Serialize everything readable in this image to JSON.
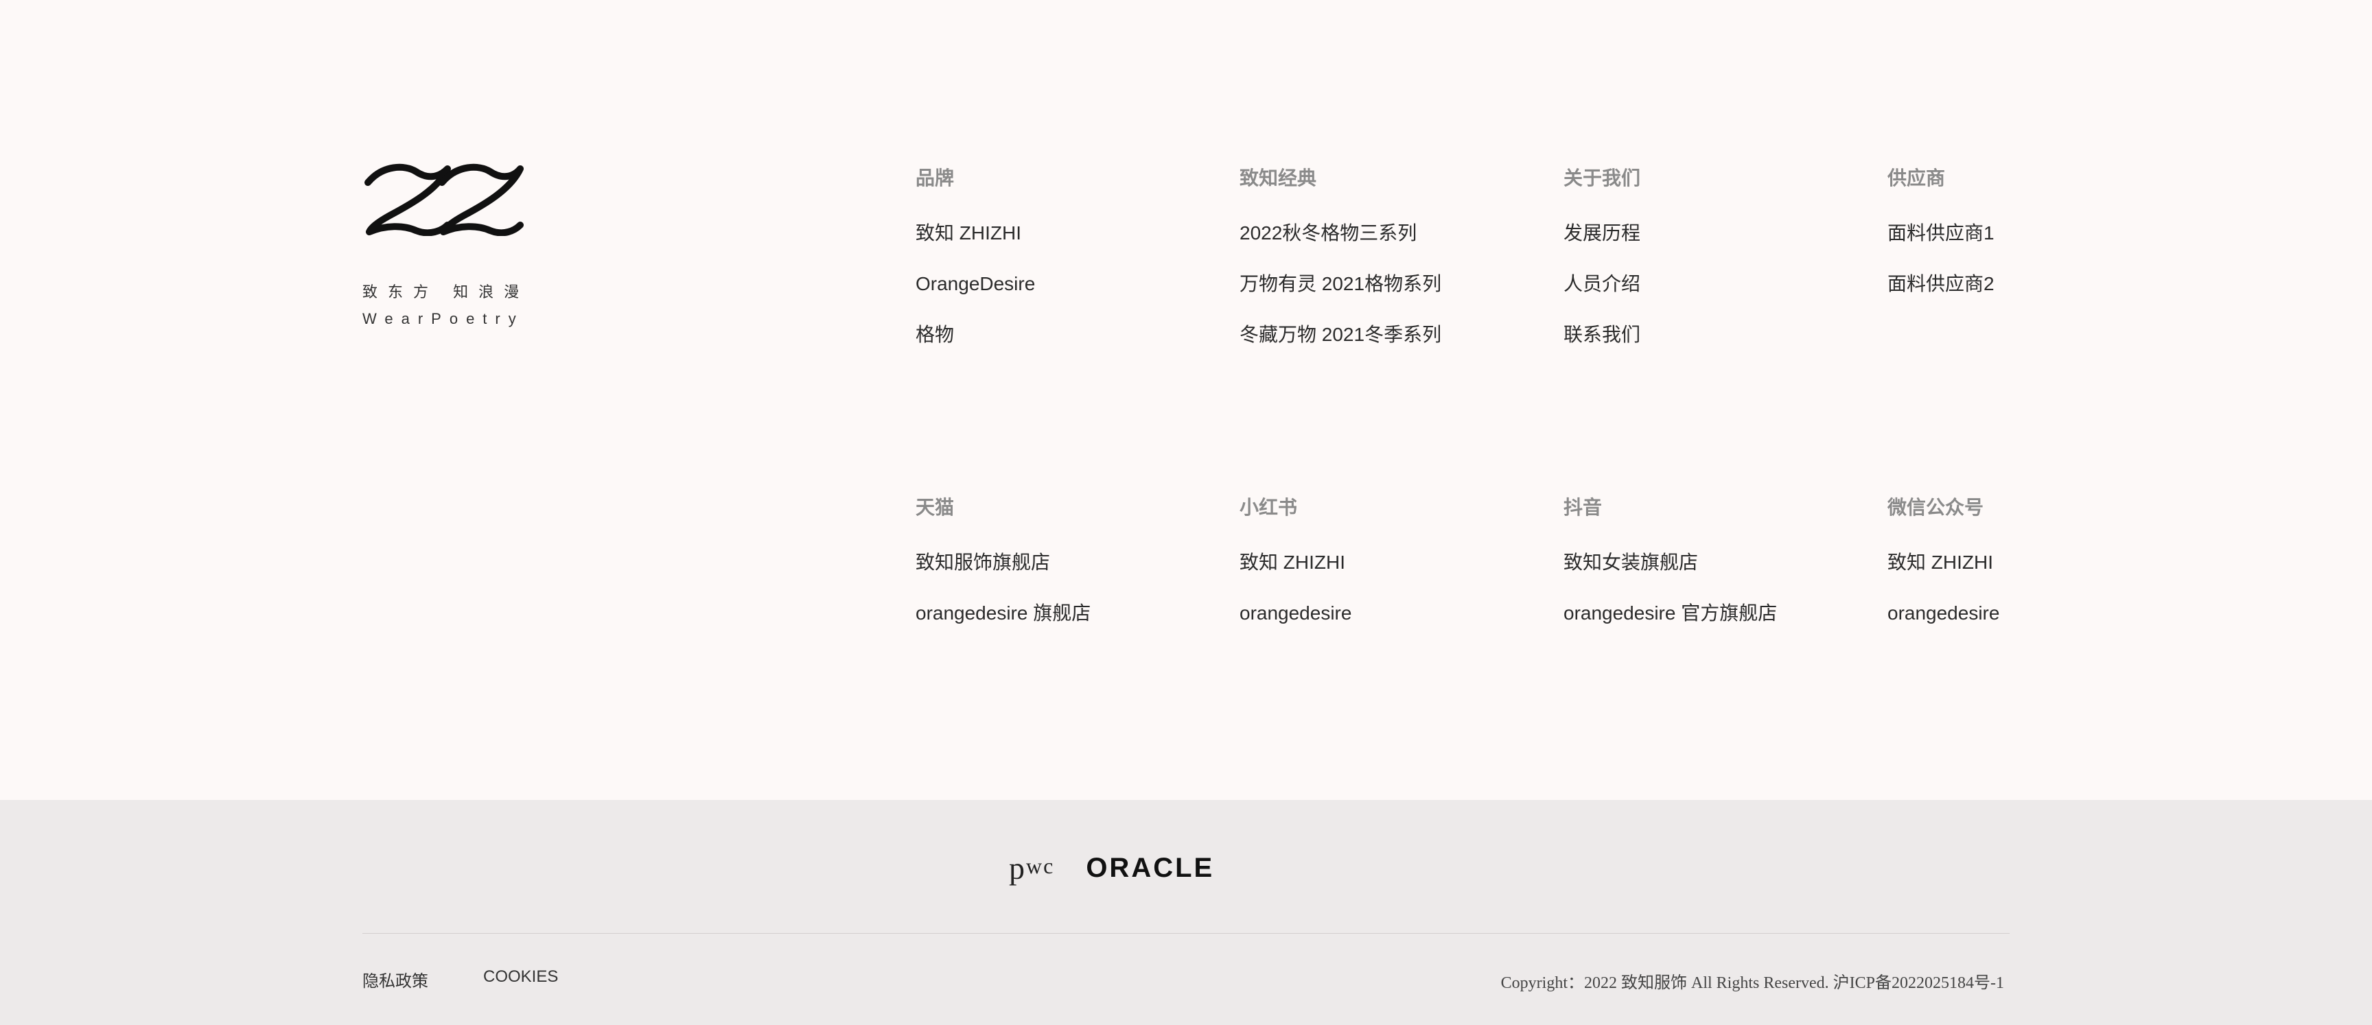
{
  "brand": {
    "logo_icon": "zz-wave-logo-icon",
    "tagline_cn": "致东方 知浪漫",
    "tagline_en": "WearPoetry"
  },
  "columns": [
    {
      "title": "品牌",
      "items": [
        "致知 ZHIZHI",
        "OrangeDesire",
        "格物"
      ]
    },
    {
      "title": "致知经典",
      "items": [
        "2022秋冬格物三系列",
        "万物有灵 2021格物系列",
        "冬藏万物 2021冬季系列"
      ]
    },
    {
      "title": "关于我们",
      "items": [
        "发展历程",
        "人员介绍",
        "联系我们"
      ]
    },
    {
      "title": "供应商",
      "items": [
        "面料供应商1",
        "面料供应商2"
      ]
    },
    {
      "title": "天猫",
      "items": [
        "致知服饰旗舰店",
        "orangedesire 旗舰店"
      ]
    },
    {
      "title": "小红书",
      "items": [
        "致知 ZHIZHI",
        "orangedesire"
      ]
    },
    {
      "title": "抖音",
      "items": [
        "致知女装旗舰店",
        "orangedesire 官方旗舰店"
      ]
    },
    {
      "title": "微信公众号",
      "items": [
        "致知 ZHIZHI",
        "orangedesire"
      ]
    }
  ],
  "partners": {
    "pwc_p": "p",
    "pwc_wc": "wc",
    "oracle": "ORACLE"
  },
  "footer": {
    "privacy_label": "隐私政策",
    "cookies_label": "COOKIES",
    "copyright": "Copyright：2022 致知服饰 All Rights Reserved.  沪ICP备2022025184号-1"
  },
  "colors": {
    "top_background": "#fdf9f8",
    "bottom_background": "#edeaea",
    "heading_gray": "#8a8a8a",
    "text_dark": "#2b2b2b"
  }
}
